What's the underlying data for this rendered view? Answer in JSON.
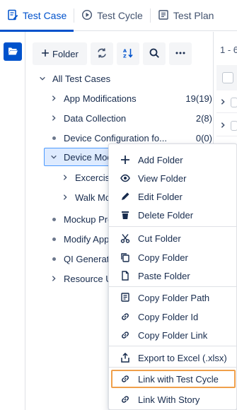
{
  "tabs": [
    {
      "label": "Test Case",
      "icon": "test-case-icon",
      "active": true
    },
    {
      "label": "Test Cycle",
      "icon": "test-cycle-icon",
      "active": false
    },
    {
      "label": "Test Plan",
      "icon": "test-plan-icon",
      "active": false
    }
  ],
  "toolbar": {
    "folder_label": "Folder",
    "icons": [
      "plus-icon",
      "refresh-icon",
      "sort-icon",
      "search-icon",
      "more-icon"
    ]
  },
  "tree": {
    "root": "All Test Cases",
    "items": [
      {
        "label": "App Modifications",
        "count": "19(19)",
        "toggle": "chevron-right"
      },
      {
        "label": "Data Collection",
        "count": "2(8)",
        "toggle": "chevron-right"
      },
      {
        "label": "Device Configuration fo...",
        "count": "0(0)",
        "toggle": "dot"
      },
      {
        "label": "Device Mod",
        "count": "",
        "toggle": "chevron-down",
        "selected": true
      },
      {
        "label": "Excercise",
        "count": "",
        "toggle": "chevron-right"
      },
      {
        "label": "Walk Mo",
        "count": "",
        "toggle": "chevron-right"
      },
      {
        "label": "Mockup Pro",
        "count": "",
        "toggle": "dot"
      },
      {
        "label": "Modify App",
        "count": "",
        "toggle": "dot"
      },
      {
        "label": "QI Generat",
        "count": "",
        "toggle": "dot"
      },
      {
        "label": "Resource U",
        "count": "",
        "toggle": "chevron-right"
      }
    ]
  },
  "right_panel": {
    "page_info": "1 - 6"
  },
  "context_menu": {
    "items": [
      {
        "label": "Add Folder",
        "icon": "plus-icon"
      },
      {
        "label": "View Folder",
        "icon": "eye-icon"
      },
      {
        "label": "Edit Folder",
        "icon": "pencil-icon"
      },
      {
        "label": "Delete Folder",
        "icon": "trash-icon"
      },
      {
        "label": "Cut Folder",
        "icon": "scissors-icon"
      },
      {
        "label": "Copy Folder",
        "icon": "copy-icon"
      },
      {
        "label": "Paste Folder",
        "icon": "paste-icon"
      },
      {
        "label": "Copy Folder Path",
        "icon": "folder-path-icon"
      },
      {
        "label": "Copy Folder Id",
        "icon": "link-icon"
      },
      {
        "label": "Copy Folder Link",
        "icon": "link-icon"
      },
      {
        "label": "Export to Excel (.xlsx)",
        "icon": "export-icon"
      },
      {
        "label": "Link with Test Cycle",
        "icon": "link-icon",
        "highlighted": true
      },
      {
        "label": "Link With Story",
        "icon": "link-icon"
      }
    ]
  },
  "colors": {
    "accent": "#0052cc",
    "selected_bg": "#deebff",
    "highlight_border": "#f0a04b"
  }
}
